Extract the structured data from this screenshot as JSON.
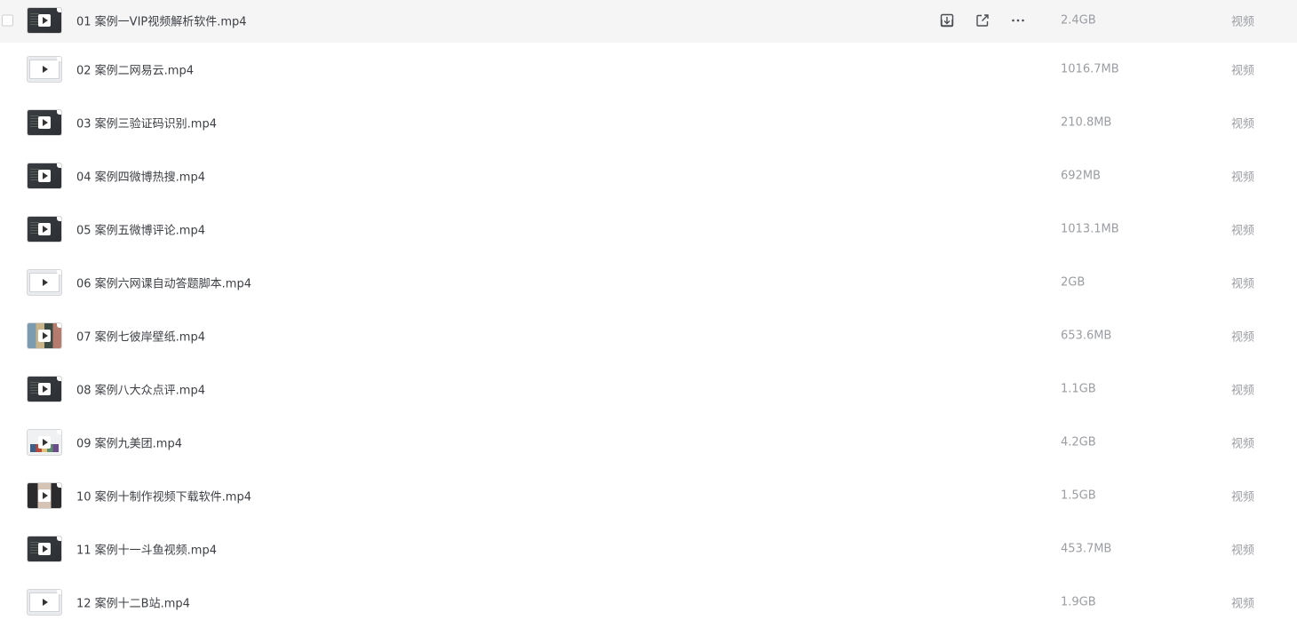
{
  "files": [
    {
      "name": "01 案例一VIP视频解析软件.mp4",
      "size": "2.4GB",
      "type": "视频",
      "thumb": "dark",
      "hovered": true
    },
    {
      "name": "02 案例二网易云.mp4",
      "size": "1016.7MB",
      "type": "视频",
      "thumb": "light"
    },
    {
      "name": "03 案例三验证码识别.mp4",
      "size": "210.8MB",
      "type": "视频",
      "thumb": "dark"
    },
    {
      "name": "04 案例四微博热搜.mp4",
      "size": "692MB",
      "type": "视频",
      "thumb": "dark"
    },
    {
      "name": "05 案例五微博评论.mp4",
      "size": "1013.1MB",
      "type": "视频",
      "thumb": "dark"
    },
    {
      "name": "06 案例六网课自动答题脚本.mp4",
      "size": "2GB",
      "type": "视频",
      "thumb": "light"
    },
    {
      "name": "07 案例七彼岸壁纸.mp4",
      "size": "653.6MB",
      "type": "视频",
      "thumb": "colorful"
    },
    {
      "name": "08 案例八大众点评.mp4",
      "size": "1.1GB",
      "type": "视频",
      "thumb": "dark"
    },
    {
      "name": "09 案例九美团.mp4",
      "size": "4.2GB",
      "type": "视频",
      "thumb": "grid"
    },
    {
      "name": "10 案例十制作视频下载软件.mp4",
      "size": "1.5GB",
      "type": "视频",
      "thumb": "photo"
    },
    {
      "name": "11 案例十一斗鱼视频.mp4",
      "size": "453.7MB",
      "type": "视频",
      "thumb": "dark"
    },
    {
      "name": "12 案例十二B站.mp4",
      "size": "1.9GB",
      "type": "视频",
      "thumb": "light"
    }
  ],
  "row_actions": [
    {
      "icon": "download-icon"
    },
    {
      "icon": "share-icon"
    },
    {
      "icon": "more-icon"
    }
  ]
}
